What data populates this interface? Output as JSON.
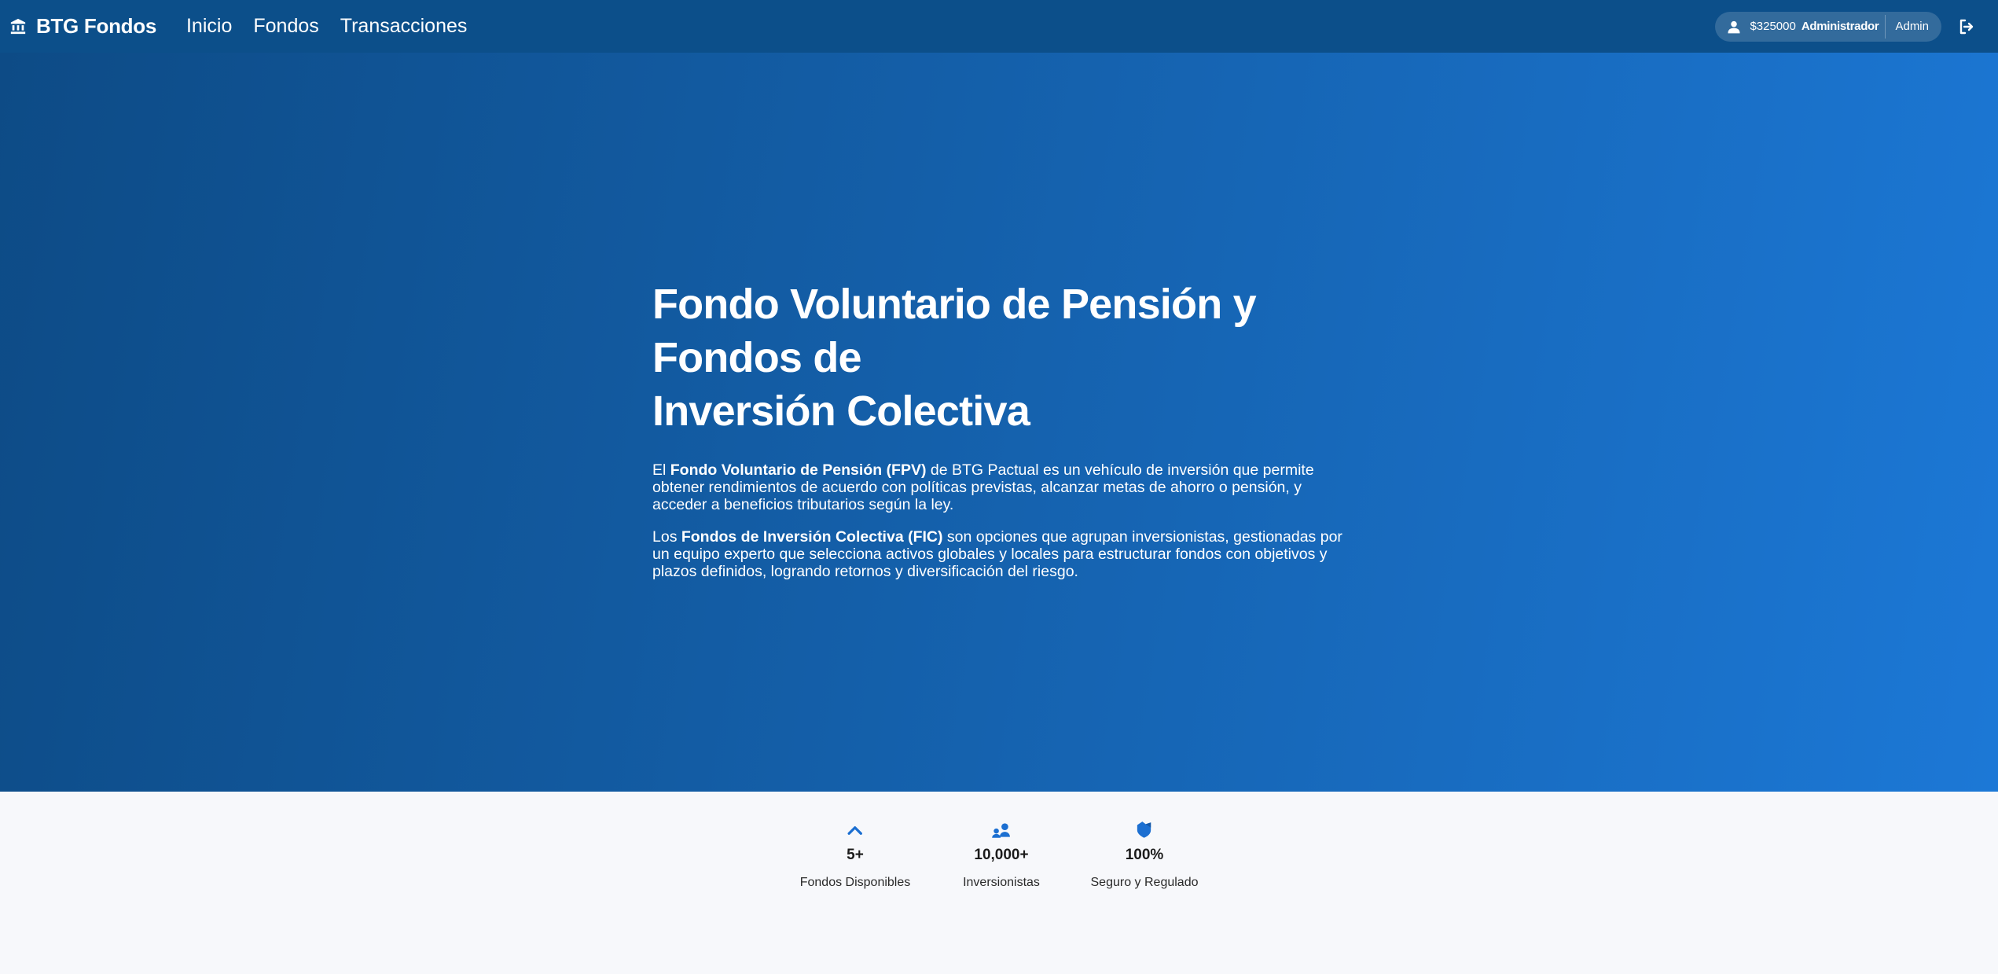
{
  "navbar": {
    "brand": "BTG Fondos",
    "brand_icon": "bank-icon",
    "links": [
      "Inicio",
      "Fondos",
      "Transacciones"
    ],
    "balance": "$325000",
    "user_name": "Administrador",
    "role": "Admin",
    "user_icon": "user-icon",
    "logout_icon": "logout-icon",
    "bg_color": "#0c4f8a"
  },
  "hero": {
    "title_line1": "Fondo Voluntario de Pensión y",
    "title_line2": "Fondos de",
    "title_line3": "Inversión Colectiva",
    "p1_prefix": "El ",
    "p1_bold": "Fondo Voluntario de Pensión (FPV)",
    "p1_rest": " de BTG Pactual es un vehículo de inversión que permite obtener rendimientos de acuerdo con políticas previstas, alcanzar metas de ahorro o pensión, y acceder a beneficios tributarios según la ley.",
    "p2_prefix": "Los ",
    "p2_bold": "Fondos de Inversión Colectiva (FIC)",
    "p2_rest": " son opciones que agrupan inversionistas, gestionadas por un equipo experto que selecciona activos globales y locales para estructurar fondos con objetivos y plazos definidos, logrando retornos y diversificación del riesgo.",
    "gradient_start": "#0d4b86",
    "gradient_end": "#1c78d6"
  },
  "stats": [
    {
      "icon": "trending-up-icon",
      "value": "5+",
      "label": "Fondos Disponibles"
    },
    {
      "icon": "people-icon",
      "value": "10,000+",
      "label": "Inversionistas"
    },
    {
      "icon": "shield-icon",
      "value": "100%",
      "label": "Seguro y Regulado"
    }
  ],
  "accent_color": "#1c6fd1"
}
